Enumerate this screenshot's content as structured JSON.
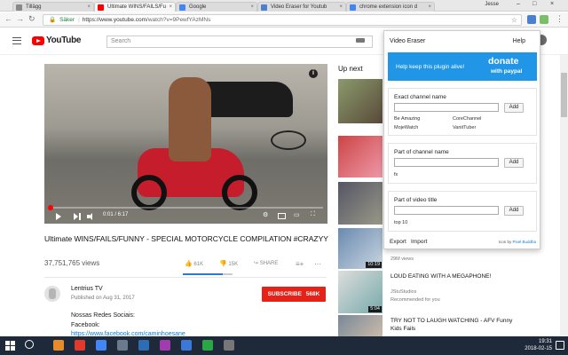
{
  "browser": {
    "tabs": [
      {
        "label": "Tillägg",
        "color": "#888888",
        "active": false
      },
      {
        "label": "Ultimate WINS/FAILS/Fu",
        "color": "#ff0000",
        "active": true
      },
      {
        "label": "Google",
        "color": "#4285f4",
        "active": false
      },
      {
        "label": "Video Eraser for Youtub",
        "color": "#4a7fd1",
        "active": false
      },
      {
        "label": "chrome extension icon d",
        "color": "#4285f4",
        "active": false
      }
    ],
    "user_name": "Jesse",
    "address": {
      "secure_label": "Säker",
      "separator": "|",
      "url_host": "https://www.youtube.com",
      "url_path": "/watch?v=9PewfYAzMNs"
    }
  },
  "youtube": {
    "logo_text": "YouTube",
    "search_placeholder": "Search",
    "video": {
      "time": "0:01 / 6:17",
      "progress_fraction": 0.003,
      "title": "Ultimate WINS/FAILS/FUNNY - SPECIAL MOTORCYCLE COMPILATION #CRAZYY",
      "views": "37,751,765 views",
      "likes": "61K",
      "dislikes": "15K",
      "share_label": "SHARE",
      "like_fraction": 0.8
    },
    "channel": {
      "name": "Lentrius TV",
      "published": "Published on Aug 31, 2017",
      "subscribe_label": "SUBSCRIBE",
      "subscriber_count": "568K"
    },
    "description": {
      "line1": "Nossas Redes Sociais:",
      "line2": "Facebook:",
      "line3": "https://www.facebook.com/caminhoesane"
    },
    "up_next_label": "Up next",
    "recommendations": [
      {
        "duration": "",
        "title": "",
        "channel": "",
        "meta": ""
      },
      {
        "duration": "",
        "title": "",
        "channel": "",
        "meta": ""
      },
      {
        "duration": "",
        "title": "",
        "channel": "",
        "meta": ""
      },
      {
        "duration": "10:19",
        "title": "",
        "channel": "",
        "meta": "29M views"
      },
      {
        "duration": "5:04",
        "title": "LOUD EATING WITH A MEGAPHONE!",
        "channel": "JStuStudios",
        "meta": "Recommended for you"
      },
      {
        "duration": "",
        "title": "TRY NOT TO LAUGH WATCHING - AFV Funny Kids Fails",
        "channel": "",
        "meta": ""
      }
    ]
  },
  "popup": {
    "title": "Video Eraser",
    "help": "Help",
    "donate_message": "Help keep this plugin alive!",
    "donate_big": "donate",
    "donate_small": "with paypal",
    "sections": [
      {
        "label": "Exact channel name",
        "add_label": "Add",
        "entries": [
          "Be Amazing",
          "CoreChannel",
          "MojeWatch",
          "VanitTuber"
        ]
      },
      {
        "label": "Part of channel name",
        "add_label": "Add",
        "entries": [
          "fx"
        ]
      },
      {
        "label": "Part of video title",
        "add_label": "Add",
        "entries": [
          "top 10"
        ]
      }
    ],
    "export_label": "Export",
    "import_label": "Import",
    "credit_prefix": "Icon by",
    "credit_link": "Pixel Buddha"
  },
  "taskbar": {
    "time": "19:31",
    "date": "2018-02-15",
    "app_colors": [
      "#e88b2b",
      "#e23a2a",
      "#4285f4",
      "#6b7a8f",
      "#2d6db5",
      "#a33bb0",
      "#3c78d8",
      "#29a745",
      "#777777"
    ]
  }
}
